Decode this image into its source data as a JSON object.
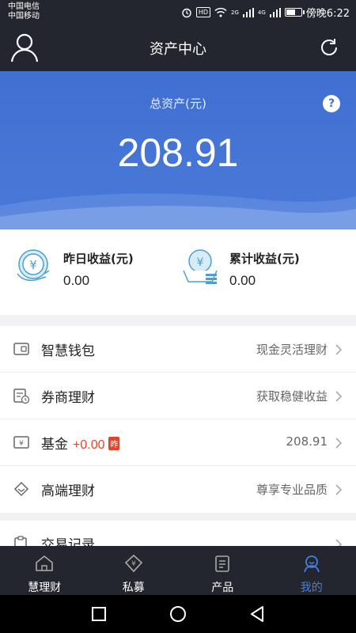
{
  "status_bar": {
    "carrier_1": "中国电信",
    "carrier_2": "中国移动",
    "hd": "HD",
    "net_1": "2G",
    "net_2": "4G",
    "time": "傍晚6:22"
  },
  "header": {
    "title": "资产中心"
  },
  "hero": {
    "label": "总资产(元)",
    "value": "208.91",
    "help": "?"
  },
  "earnings": {
    "yesterday": {
      "label": "昨日收益(元)",
      "value": "0.00"
    },
    "total": {
      "label": "累计收益(元)",
      "value": "0.00"
    }
  },
  "menu": {
    "items": [
      {
        "label": "智慧钱包",
        "desc": "现金灵活理财"
      },
      {
        "label": "券商理财",
        "desc": "获取稳健收益"
      },
      {
        "label": "基金",
        "change": "+0.00",
        "badge": "昨",
        "desc": "208.91"
      },
      {
        "label": "高端理财",
        "desc": "尊享专业品质"
      }
    ],
    "trade_label": "交易记录"
  },
  "tabs": [
    {
      "label": "慧理财"
    },
    {
      "label": "私募"
    },
    {
      "label": "产品"
    },
    {
      "label": "我的"
    }
  ],
  "colors": {
    "accent": "#4a7fe0",
    "hero_bg": "#4574d4",
    "dark_bar": "#23262e",
    "change_red": "#e0462f"
  }
}
